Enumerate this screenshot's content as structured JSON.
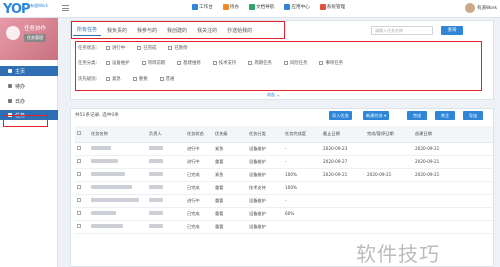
{
  "app": {
    "logo": "YOP",
    "logo_sub": "有道Work"
  },
  "topmenu": [
    {
      "label": "工作台",
      "icon": "workbench-icon",
      "color": "#2f86d6"
    },
    {
      "label": "待办",
      "icon": "todo-icon",
      "color": "#f08a24"
    },
    {
      "label": "文档导航",
      "icon": "doc-nav-icon",
      "color": "#2fa36b"
    },
    {
      "label": "应用中心",
      "icon": "app-center-icon",
      "color": "#2f86d6"
    },
    {
      "label": "系统管理",
      "icon": "system-icon",
      "color": "#e0523c"
    }
  ],
  "user": {
    "name": "有道Work"
  },
  "sidebar": {
    "profile_title": "任务协作",
    "profile_button": "任务管理",
    "items": [
      {
        "label": "主页"
      },
      {
        "label": "待办"
      },
      {
        "label": "日办"
      },
      {
        "label": "任务"
      }
    ]
  },
  "tabs": [
    "所有任务",
    "我负责的",
    "我参与的",
    "我创建的",
    "我关注的",
    "抄送给我的"
  ],
  "search": {
    "placeholder": "请输入任务名称",
    "button": "查询"
  },
  "filters": [
    {
      "label": "任务状态:",
      "options": [
        "进行中",
        "已完成",
        "已暂停"
      ]
    },
    {
      "label": "任务分类:",
      "options": [
        "设备维护",
        "项目前期",
        "基建维修",
        "技术支持",
        "周期任务",
        "风险任务",
        "事项任务"
      ]
    },
    {
      "label": "优先级别:",
      "options": [
        "紧急",
        "重要",
        "普通"
      ]
    }
  ],
  "collapse_label": "收起 ︿",
  "list": {
    "summary": "共51条记录, 选中0条",
    "buttons": [
      {
        "label": "导入任务",
        "color": "#2f86d6"
      },
      {
        "label": "新建任务 ▾",
        "color": "#2f86d6"
      },
      {
        "label": "完成",
        "color": "#2f86d6"
      },
      {
        "label": "关注",
        "color": "#2f86d6"
      },
      {
        "label": "导出",
        "color": "#2f86d6"
      }
    ],
    "columns": [
      "",
      "任务名称",
      "负责人",
      "任务状态",
      "优先级",
      "任务分类",
      "任务完成度",
      "截止日期",
      "完成/暂停日期",
      "创建日期"
    ],
    "rows": [
      {
        "status": "进行中",
        "priority": "紧急",
        "category": "设备维护",
        "progress": "-",
        "due": "2020-09-23",
        "done": "",
        "created": "2020-09-21"
      },
      {
        "status": "进行中",
        "priority": "重要",
        "category": "设备维护",
        "progress": "-",
        "due": "2020-09-27",
        "done": "",
        "created": "2020-09-21"
      },
      {
        "status": "已完成",
        "priority": "紧急",
        "category": "设备维护",
        "progress": "100%",
        "due": "2020-09-21",
        "done": "2020-09-21",
        "created": "2020-09-21"
      },
      {
        "status": "已完成",
        "priority": "重要",
        "category": "技术支持",
        "progress": "100%",
        "due": "",
        "done": "",
        "created": ""
      },
      {
        "status": "进行中",
        "priority": "重要",
        "category": "设备维护",
        "progress": "-",
        "due": "",
        "done": "",
        "created": ""
      },
      {
        "status": "已完成",
        "priority": "重要",
        "category": "设备维护",
        "progress": "60%",
        "due": "",
        "done": "",
        "created": ""
      },
      {
        "status": "已完成",
        "priority": "重要",
        "category": "设备维护",
        "progress": "",
        "due": "",
        "done": "",
        "created": ""
      }
    ]
  },
  "watermark": "软件技巧"
}
